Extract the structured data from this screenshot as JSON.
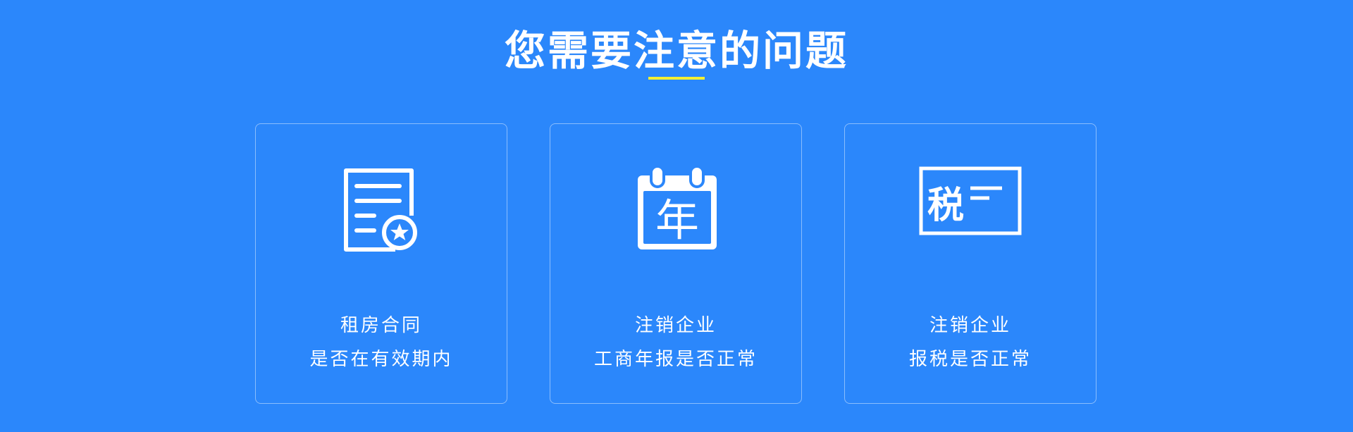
{
  "title": "您需要注意的问题",
  "colors": {
    "background": "#2b87fb",
    "accent_underline": "#f2ef32",
    "text": "#ffffff"
  },
  "cards": [
    {
      "icon": "contract-certificate-icon",
      "line1": "租房合同",
      "line2": "是否在有效期内"
    },
    {
      "icon": "calendar-year-icon",
      "icon_text": "年",
      "line1": "注销企业",
      "line2": "工商年报是否正常"
    },
    {
      "icon": "tax-card-icon",
      "icon_text": "税",
      "line1": "注销企业",
      "line2": "报税是否正常"
    }
  ]
}
